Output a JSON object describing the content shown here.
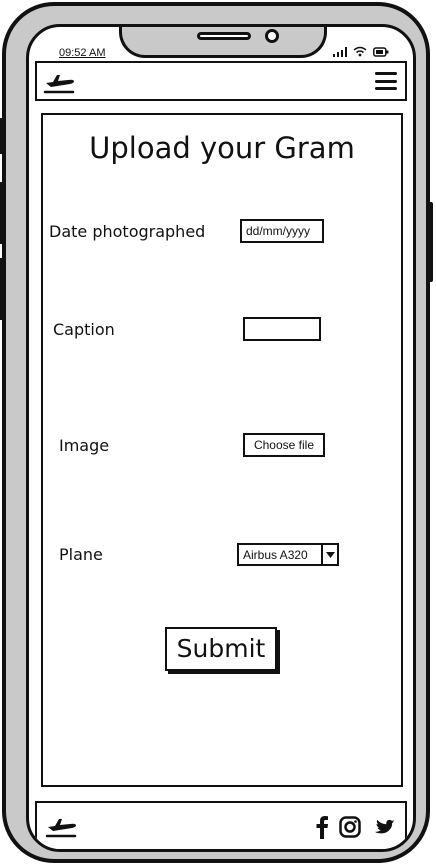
{
  "status_bar": {
    "time": "09:52 AM"
  },
  "header": {
    "logo_icon": "plane-departure-icon",
    "menu_icon": "hamburger-menu-icon"
  },
  "form": {
    "title": "Upload your Gram",
    "date": {
      "label": "Date photographed",
      "placeholder": "dd/mm/yyyy"
    },
    "caption": {
      "label": "Caption",
      "value": ""
    },
    "image": {
      "label": "Image",
      "button_label": "Choose file"
    },
    "plane": {
      "label": "Plane",
      "selected": "Airbus A320"
    },
    "submit_label": "Submit"
  },
  "footer": {
    "logo_icon": "plane-departure-icon",
    "social_icons": [
      "facebook-icon",
      "instagram-icon",
      "twitter-icon"
    ]
  }
}
